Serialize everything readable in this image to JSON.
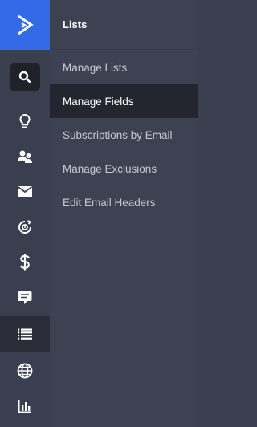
{
  "colors": {
    "brand": "#356ae6",
    "rail_bg": "#3a3f50",
    "panel_bg": "#3d4253",
    "active_bg": "#23262f",
    "text": "#c6c9d3",
    "text_active": "#ffffff"
  },
  "rail": {
    "items": [
      {
        "icon": "search-icon"
      },
      {
        "icon": "lightbulb-icon"
      },
      {
        "icon": "contacts-icon"
      },
      {
        "icon": "mail-icon"
      },
      {
        "icon": "automation-icon"
      },
      {
        "icon": "dollar-icon"
      },
      {
        "icon": "chat-icon"
      },
      {
        "icon": "list-icon",
        "active": true
      },
      {
        "icon": "globe-icon"
      },
      {
        "icon": "bar-chart-icon"
      }
    ]
  },
  "panel": {
    "title": "Lists",
    "items": [
      {
        "label": "Manage Lists"
      },
      {
        "label": "Manage Fields",
        "active": true
      },
      {
        "label": "Subscriptions by Email"
      },
      {
        "label": "Manage Exclusions"
      },
      {
        "label": "Edit Email Headers"
      }
    ]
  }
}
